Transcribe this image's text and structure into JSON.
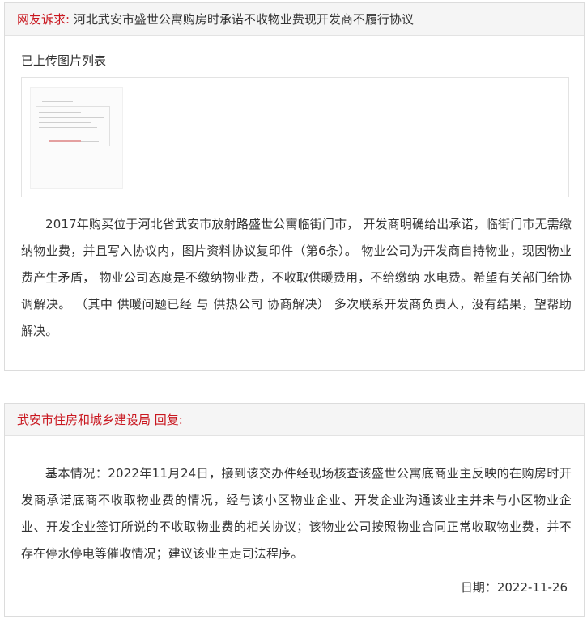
{
  "complaint": {
    "label": "网友诉求:",
    "title": "河北武安市盛世公寓购房时承诺不收物业费现开发商不履行协议",
    "gallery_title": "已上传图片列表",
    "body": "2017年购买位于河北省武安市放射路盛世公寓临街门市， 开发商明确给出承诺，临街门市无需缴纳物业费，并且写入协议内，图片资料协议复印件（第6条）。 物业公司为开发商自持物业，现因物业费产生矛盾， 物业公司态度是不缴纳物业费，不收取供暖费用，不给缴纳 水电费。希望有关部门给协调解决。 （其中 供暖问题已经 与 供热公司 协商解决） 多次联系开发商负责人，没有结果，望帮助解决。"
  },
  "reply": {
    "department": "武安市住房和城乡建设局 回复:",
    "body": "基本情况：2022年11月24日，接到该交办件经现场核查该盛世公寓底商业主反映的在购房时开发商承诺底商不收取物业费的情况，经与该小区物业企业、开发企业沟通该业主并未与小区物业企业、开发企业签订所说的不收取物业费的相关协议；该物业公司按照物业合同正常收取物业费，并不存在停水停电等催收情况；建议该业主走司法程序。",
    "date": "日期：2022-11-26"
  },
  "colors": {
    "accent_red": "#c9171f",
    "header_bg": "#f5f5f5",
    "border": "#dcdcdc",
    "text": "#333333"
  }
}
